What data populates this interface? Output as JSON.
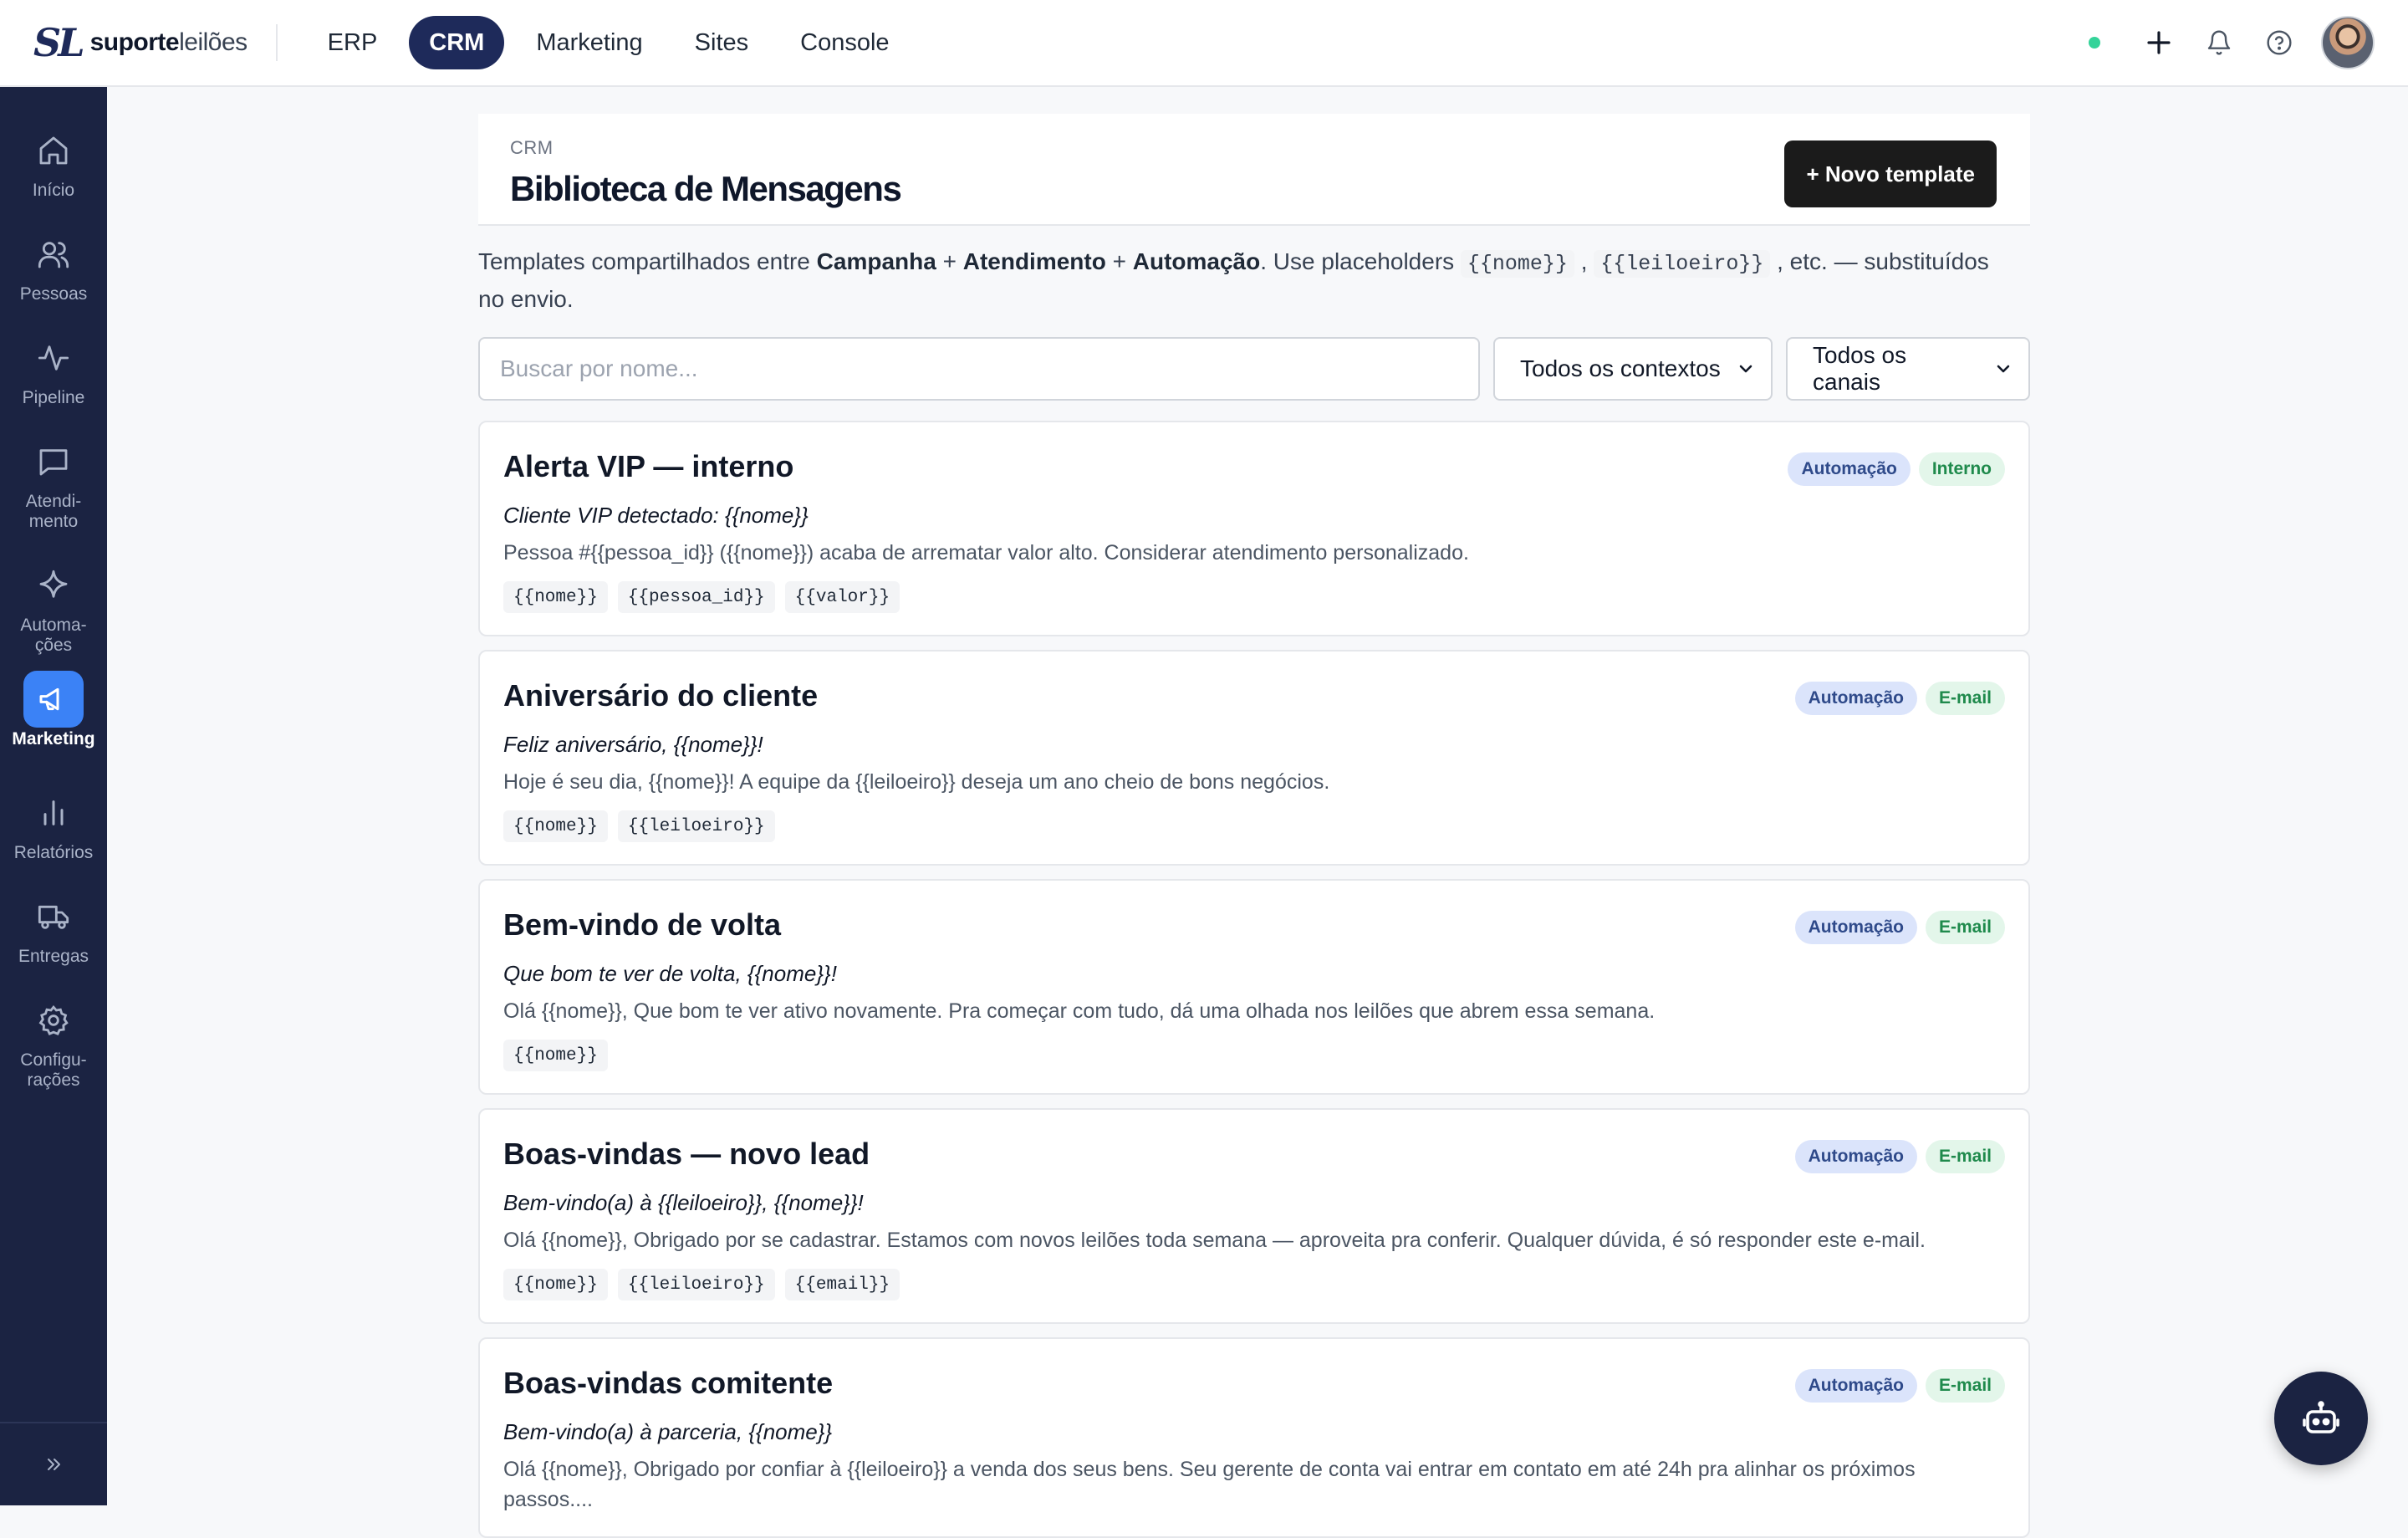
{
  "brand": {
    "mark": "SL",
    "name_bold": "suporte",
    "name_light": "leilões"
  },
  "topnav": [
    {
      "label": "ERP"
    },
    {
      "label": "CRM",
      "active": true
    },
    {
      "label": "Marketing"
    },
    {
      "label": "Sites"
    },
    {
      "label": "Console"
    }
  ],
  "sidebar": {
    "items": [
      {
        "label": "Início",
        "icon": "home-icon"
      },
      {
        "label": "Pessoas",
        "icon": "users-icon"
      },
      {
        "label": "Pipeline",
        "icon": "activity-icon"
      },
      {
        "label": "Atendi-\nmento",
        "icon": "chat-icon"
      },
      {
        "label": "Automa-\nções",
        "icon": "sparkle-icon"
      },
      {
        "label": "Marketing",
        "icon": "megaphone-icon",
        "active": true
      },
      {
        "label": "Relatórios",
        "icon": "bar-chart-icon"
      },
      {
        "label": "Entregas",
        "icon": "truck-icon"
      },
      {
        "label": "Configu-\nrações",
        "icon": "gear-icon"
      }
    ]
  },
  "page": {
    "breadcrumb": "CRM",
    "title": "Biblioteca de Mensagens",
    "new_button": "+ Novo template",
    "intro": {
      "t1": "Templates compartilhados entre ",
      "b1": "Campanha",
      "t2": " + ",
      "b2": "Atendimento",
      "t3": " + ",
      "b3": "Automação",
      "t4": ". Use placeholders ",
      "c1": "{{nome}}",
      "t5": " , ",
      "c2": "{{leiloeiro}}",
      "t6": " , etc. — substituídos no envio."
    },
    "search_placeholder": "Buscar por nome...",
    "context_filter": "Todos os contextos",
    "channel_filter": "Todos os canais"
  },
  "templates": [
    {
      "title": "Alerta VIP — interno",
      "badges": [
        "Automação",
        "Interno"
      ],
      "subject": "Cliente VIP detectado: {{nome}}",
      "body": "Pessoa #{{pessoa_id}} ({{nome}}) acaba de arrematar valor alto. Considerar atendimento personalizado.",
      "tags": [
        "{{nome}}",
        "{{pessoa_id}}",
        "{{valor}}"
      ]
    },
    {
      "title": "Aniversário do cliente",
      "badges": [
        "Automação",
        "E-mail"
      ],
      "subject": "Feliz aniversário, {{nome}}!",
      "body": "Hoje é seu dia, {{nome}}! A equipe da {{leiloeiro}} deseja um ano cheio de bons negócios.",
      "tags": [
        "{{nome}}",
        "{{leiloeiro}}"
      ]
    },
    {
      "title": "Bem-vindo de volta",
      "badges": [
        "Automação",
        "E-mail"
      ],
      "subject": "Que bom te ver de volta, {{nome}}!",
      "body": "Olá {{nome}}, Que bom te ver ativo novamente. Pra começar com tudo, dá uma olhada nos leilões que abrem essa semana.",
      "tags": [
        "{{nome}}"
      ]
    },
    {
      "title": "Boas-vindas — novo lead",
      "badges": [
        "Automação",
        "E-mail"
      ],
      "subject": "Bem-vindo(a) à {{leiloeiro}}, {{nome}}!",
      "body": "Olá {{nome}}, Obrigado por se cadastrar. Estamos com novos leilões toda semana — aproveita pra conferir. Qualquer dúvida, é só responder este e-mail.",
      "tags": [
        "{{nome}}",
        "{{leiloeiro}}",
        "{{email}}"
      ]
    },
    {
      "title": "Boas-vindas comitente",
      "badges": [
        "Automação",
        "E-mail"
      ],
      "subject": "Bem-vindo(a) à parceria, {{nome}}",
      "body": "Olá {{nome}}, Obrigado por confiar à {{leiloeiro}} a venda dos seus bens. Seu gerente de conta vai entrar em contato em até 24h pra alinhar os próximos passos....",
      "tags": []
    }
  ],
  "colors": {
    "sidebar_bg": "#1b2342",
    "active_nav": "#1e2a5a",
    "accent_blue": "#3b82f6",
    "status_online": "#34d399",
    "primary_button": "#1b1b1b"
  }
}
